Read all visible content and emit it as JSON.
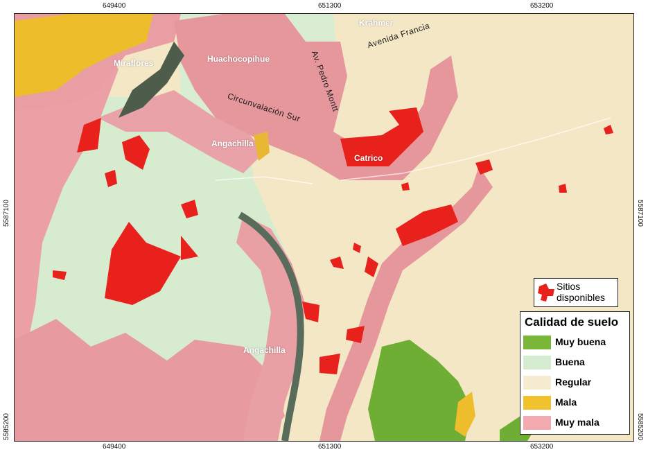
{
  "map": {
    "ticks_top": [
      "649400",
      "651300",
      "653200"
    ],
    "ticks_bottom": [
      "649400",
      "651300",
      "653200"
    ],
    "ticks_left": [
      "5587100",
      "5585200"
    ],
    "ticks_right": [
      "5587100",
      "5585200"
    ],
    "place_names": {
      "miraflores": "Miraflores",
      "huachocopihue": "Huachocopihue",
      "angachilla_north": "Angachilla",
      "angachilla_south": "Angachilla",
      "catrico": "Catrico",
      "krahmer": "Krahmer"
    },
    "street_names": {
      "avenida_francia": "Avenida Francia",
      "pedro_montt": "Av. Pedro Montt",
      "circunvalacion": "Circunvalación Sur"
    }
  },
  "sitios_legend": {
    "label": "Sitios disponibles",
    "color": "#e8211c"
  },
  "soil_legend": {
    "title": "Calidad de suelo",
    "items": [
      {
        "label": "Muy buena",
        "color": "#7ab637"
      },
      {
        "label": "Buena",
        "color": "#d6ecd0"
      },
      {
        "label": "Regular",
        "color": "#f6ecd2"
      },
      {
        "label": "Mala",
        "color": "#f2c12e"
      },
      {
        "label": "Muy mala",
        "color": "#f2aab0"
      }
    ]
  }
}
